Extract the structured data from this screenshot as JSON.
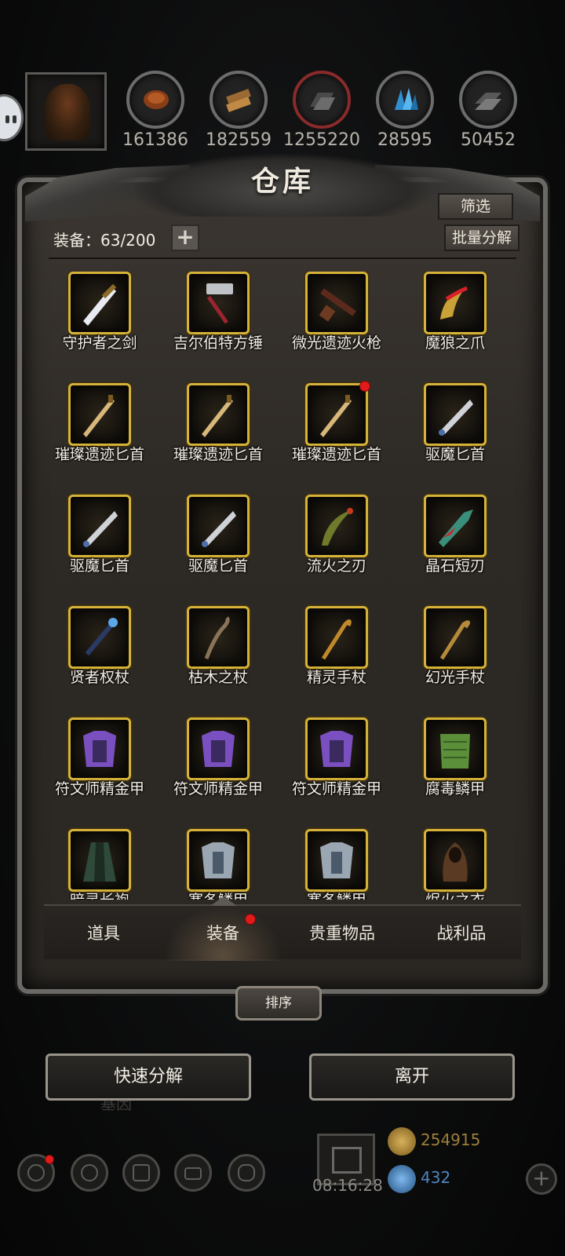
{
  "colors": {
    "gold_frame": "#d6b338",
    "badge_red": "#e11a1a",
    "panel_bg": "#2d2925"
  },
  "resources": [
    {
      "icon": "meat-icon",
      "value": "161386"
    },
    {
      "icon": "wood-icon",
      "value": "182559"
    },
    {
      "icon": "iron-ingot-icon",
      "value": "1255220"
    },
    {
      "icon": "blue-crystal-icon",
      "value": "28595"
    },
    {
      "icon": "stone-brick-icon",
      "value": "50452"
    }
  ],
  "panel": {
    "title": "仓库",
    "filter_label": "筛选",
    "batch_label": "批量分解",
    "equip_count": "装备：63/200",
    "plus": "+"
  },
  "items": [
    {
      "name": "守护者之剑",
      "icon": "sword-icon",
      "badge": false
    },
    {
      "name": "吉尔伯特方锤",
      "icon": "hammer-icon",
      "badge": false
    },
    {
      "name": "微光遗迹火枪",
      "icon": "musket-icon",
      "badge": false
    },
    {
      "name": "魔狼之爪",
      "icon": "claw-icon",
      "badge": false
    },
    {
      "name": "璀璨遗迹匕首",
      "icon": "dagger-icon",
      "badge": false
    },
    {
      "name": "璀璨遗迹匕首",
      "icon": "dagger-icon",
      "badge": false
    },
    {
      "name": "璀璨遗迹匕首",
      "icon": "dagger-icon",
      "badge": true
    },
    {
      "name": "驱魔匕首",
      "icon": "exorcist-dagger-icon",
      "badge": false
    },
    {
      "name": "驱魔匕首",
      "icon": "exorcist-dagger-icon",
      "badge": false
    },
    {
      "name": "驱魔匕首",
      "icon": "exorcist-dagger-icon",
      "badge": false
    },
    {
      "name": "流火之刃",
      "icon": "curved-blade-icon",
      "badge": false
    },
    {
      "name": "晶石短刃",
      "icon": "crystal-blade-icon",
      "badge": false
    },
    {
      "name": "贤者权杖",
      "icon": "scepter-icon",
      "badge": false
    },
    {
      "name": "枯木之杖",
      "icon": "wood-staff-icon",
      "badge": false
    },
    {
      "name": "精灵手杖",
      "icon": "elf-staff-icon",
      "badge": false
    },
    {
      "name": "幻光手杖",
      "icon": "light-staff-icon",
      "badge": false
    },
    {
      "name": "符文师精金甲",
      "icon": "purple-armor-icon",
      "badge": false
    },
    {
      "name": "符文师精金甲",
      "icon": "purple-armor-icon",
      "badge": false
    },
    {
      "name": "符文师精金甲",
      "icon": "purple-armor-icon",
      "badge": false
    },
    {
      "name": "腐毒鳞甲",
      "icon": "green-scale-armor-icon",
      "badge": false
    },
    {
      "name": "暗灵长袍",
      "icon": "dark-robe-icon",
      "badge": false
    },
    {
      "name": "寒冬鳞甲",
      "icon": "frost-armor-icon",
      "badge": false
    },
    {
      "name": "寒冬鳞甲",
      "icon": "frost-armor-icon",
      "badge": false
    },
    {
      "name": "烬火之衣",
      "icon": "hooded-cloak-icon",
      "badge": false
    }
  ],
  "tabs": [
    {
      "label": "道具",
      "active": false,
      "badge": false
    },
    {
      "label": "装备",
      "active": true,
      "badge": true
    },
    {
      "label": "贵重物品",
      "active": false,
      "badge": false
    },
    {
      "label": "战利品",
      "active": false,
      "badge": false
    }
  ],
  "sort_label": "排序",
  "buttons": {
    "quick_decompose": "快速分解",
    "leave": "离开"
  },
  "background_label": "基因",
  "hud": {
    "timer": "08:16:28",
    "gold": "254915",
    "gems": "432",
    "add": "+"
  }
}
